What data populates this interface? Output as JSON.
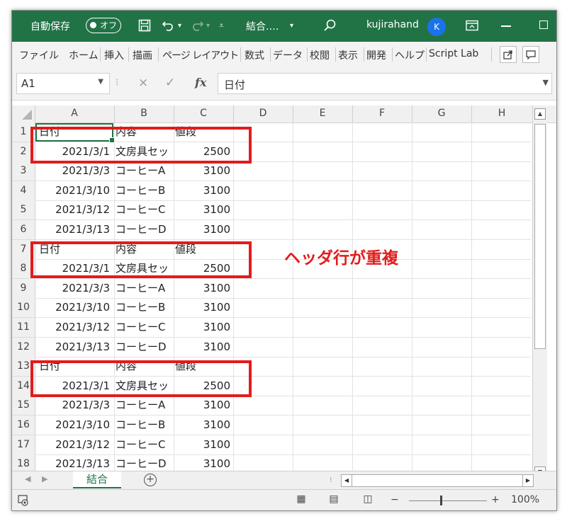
{
  "titlebar": {
    "autosave_label": "自動保存",
    "autosave_state": "オフ",
    "save_icon": "save-icon",
    "undo_icon": "undo-icon",
    "redo_icon": "redo-icon",
    "customize_icon": "customize-icon",
    "filename": "結合.…",
    "search_icon": "search-icon",
    "user_name": "kujirahand",
    "user_initial": "K",
    "ribbon_display_icon": "ribbon-display-icon",
    "minimize_icon": "minimize-icon",
    "maximize_icon": "maximize-icon",
    "accent_color": "#217346"
  },
  "ribbon": {
    "tabs": [
      "ファイル",
      "ホーム",
      "挿入",
      "描画",
      "ページ レイアウト",
      "数式",
      "データ",
      "校閲",
      "表示",
      "開発",
      "ヘルプ",
      "Script Lab"
    ],
    "share_icon": "share-icon",
    "comment_icon": "comment-icon"
  },
  "formula_bar": {
    "name_box": "A1",
    "cancel_icon": "×",
    "enter_icon": "✓",
    "fx_label": "fx",
    "content": "日付"
  },
  "grid": {
    "columns": [
      "A",
      "B",
      "C",
      "D",
      "E",
      "F",
      "G",
      "H"
    ],
    "rows": [
      {
        "num": "1",
        "a": "日付",
        "b": "内容",
        "c": "値段"
      },
      {
        "num": "2",
        "a": "2021/3/1",
        "b": "文房具セッ",
        "c": "2500"
      },
      {
        "num": "3",
        "a": "2021/3/3",
        "b": "コーヒーA",
        "c": "3100"
      },
      {
        "num": "4",
        "a": "2021/3/10",
        "b": "コーヒーB",
        "c": "3100"
      },
      {
        "num": "5",
        "a": "2021/3/12",
        "b": "コーヒーC",
        "c": "3100"
      },
      {
        "num": "6",
        "a": "2021/3/13",
        "b": "コーヒーD",
        "c": "3100"
      },
      {
        "num": "7",
        "a": "日付",
        "b": "内容",
        "c": "値段"
      },
      {
        "num": "8",
        "a": "2021/3/1",
        "b": "文房具セッ",
        "c": "2500"
      },
      {
        "num": "9",
        "a": "2021/3/3",
        "b": "コーヒーA",
        "c": "3100"
      },
      {
        "num": "10",
        "a": "2021/3/10",
        "b": "コーヒーB",
        "c": "3100"
      },
      {
        "num": "11",
        "a": "2021/3/12",
        "b": "コーヒーC",
        "c": "3100"
      },
      {
        "num": "12",
        "a": "2021/3/13",
        "b": "コーヒーD",
        "c": "3100"
      },
      {
        "num": "13",
        "a": "日付",
        "b": "内容",
        "c": "値段"
      },
      {
        "num": "14",
        "a": "2021/3/1",
        "b": "文房具セッ",
        "c": "2500"
      },
      {
        "num": "15",
        "a": "2021/3/3",
        "b": "コーヒーA",
        "c": "3100"
      },
      {
        "num": "16",
        "a": "2021/3/10",
        "b": "コーヒーB",
        "c": "3100"
      },
      {
        "num": "17",
        "a": "2021/3/12",
        "b": "コーヒーC",
        "c": "3100"
      },
      {
        "num": "18",
        "a": "2021/3/13",
        "b": "コーヒーD",
        "c": "3100"
      }
    ],
    "annotation": "ヘッダ行が重複",
    "annotation_color": "#e31b1b"
  },
  "sheets": {
    "active": "結合",
    "add_icon": "+"
  },
  "status": {
    "zoom": "100%",
    "zoom_minus": "−",
    "zoom_plus": "+"
  }
}
